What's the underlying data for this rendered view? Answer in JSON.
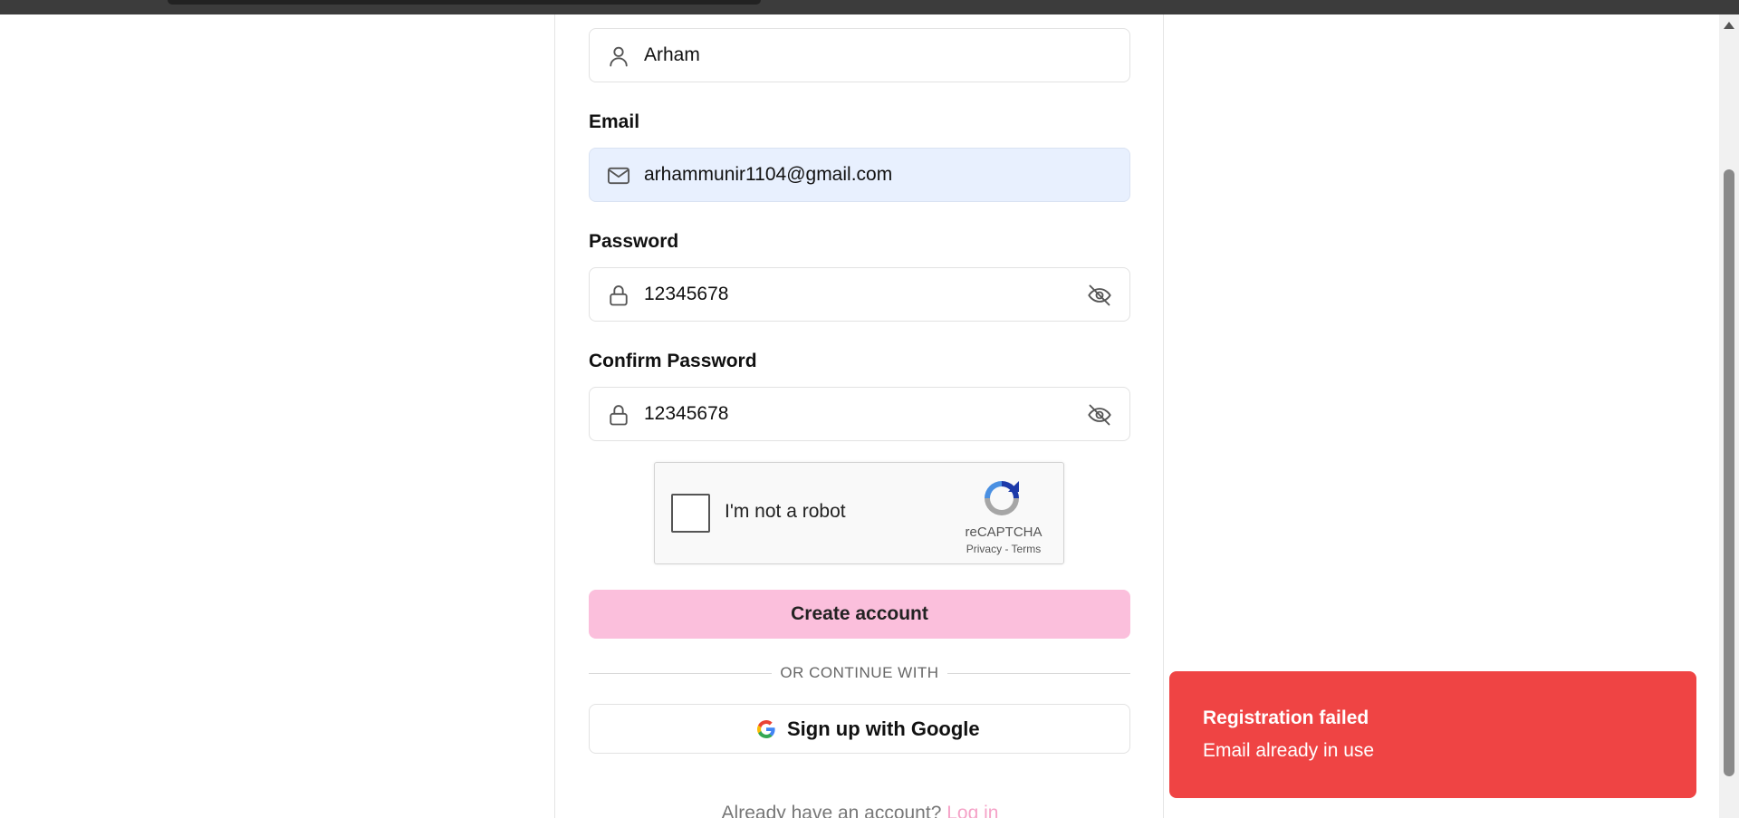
{
  "form": {
    "name_value": "Arham",
    "email_label": "Email",
    "email_value": "arhammunir1104@gmail.com",
    "password_label": "Password",
    "password_value": "12345678",
    "confirm_label": "Confirm Password",
    "confirm_value": "12345678"
  },
  "captcha": {
    "label": "I'm not a robot",
    "brand": "reCAPTCHA",
    "links": "Privacy - Terms"
  },
  "actions": {
    "create_label": "Create account",
    "divider_text": "OR CONTINUE WITH",
    "google_label": "Sign up with Google",
    "login_prompt": "Already have an account?",
    "login_link": "Log in"
  },
  "toast": {
    "title": "Registration failed",
    "message": "Email already in use"
  },
  "colors": {
    "primary_button": "#fbbfdc",
    "toast_bg": "#ef4444",
    "link": "#f5a3c8",
    "autofill_bg": "#e8f0fe"
  },
  "icons": {
    "name_field": "user-icon",
    "email_field": "mail-icon",
    "password_field": "lock-icon",
    "visibility_toggle": "eye-off-icon"
  }
}
